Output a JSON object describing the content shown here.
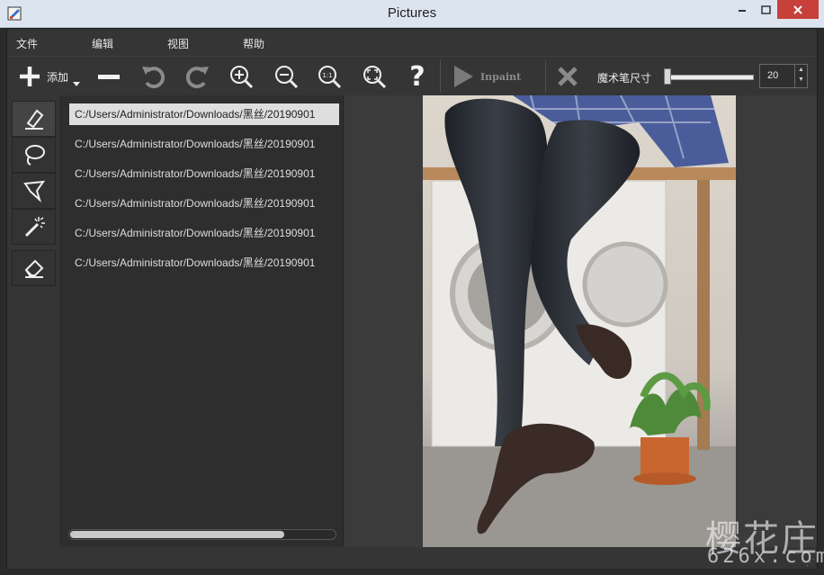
{
  "window": {
    "title": "Pictures"
  },
  "menu": [
    "文件",
    "编辑",
    "视图",
    "帮助"
  ],
  "toolbar": {
    "add_label": "添加",
    "inpaint_label": "Inpaint",
    "brush_size_label": "魔术笔尺寸",
    "brush_size_value": "20"
  },
  "icons": {
    "add": "plus-icon",
    "remove": "minus-icon",
    "undo": "undo-icon",
    "redo": "redo-icon",
    "zoom_in": "zoom-in-icon",
    "zoom_out": "zoom-out-icon",
    "zoom_actual": "zoom-1to1-icon",
    "zoom_fit": "zoom-fit-icon",
    "help": "help-icon",
    "inpaint": "play-icon",
    "clear": "close-x-icon",
    "tools": [
      "marker-icon",
      "lasso-icon",
      "polygon-lasso-icon",
      "magic-wand-icon",
      "eraser-icon"
    ]
  },
  "files": [
    "C:/Users/Administrator/Downloads/黑丝/20190901",
    "C:/Users/Administrator/Downloads/黑丝/20190901",
    "C:/Users/Administrator/Downloads/黑丝/20190901",
    "C:/Users/Administrator/Downloads/黑丝/20190901",
    "C:/Users/Administrator/Downloads/黑丝/20190901",
    "C:/Users/Administrator/Downloads/黑丝/20190901"
  ],
  "watermark": {
    "cn": "樱花庄",
    "en": "626x.com"
  },
  "colors": {
    "titlebar": "#dce5ef",
    "close_button": "#c7403a",
    "panel": "#353535",
    "canvas": "#3b3b3b"
  }
}
